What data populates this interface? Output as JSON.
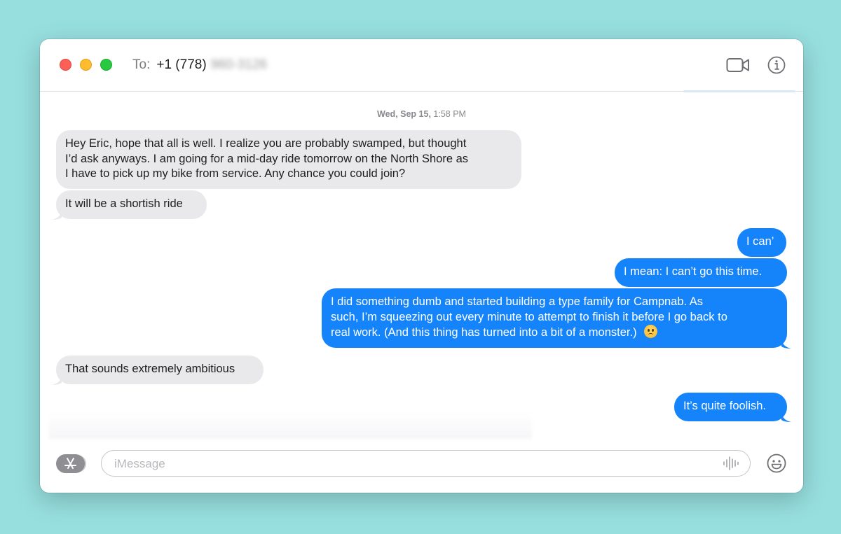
{
  "window": {
    "to_label": "To:",
    "recipient_number": "+1 (778)",
    "recipient_number_hidden": "960-3126"
  },
  "icons": {
    "video": "video-camera-icon",
    "info": "info-icon",
    "apps": "app-store-icon",
    "audio": "audio-waveform-icon",
    "emoji": "emoji-face-icon"
  },
  "colors": {
    "incoming_bubble": "#e9e9eb",
    "outgoing_bubble": "#1584fb",
    "background": "#97dfdf"
  },
  "transcript": {
    "timestamp_day": "Wed, Sep 15,",
    "timestamp_time": "1:58 PM",
    "messages": [
      {
        "direction": "incoming",
        "lines": [
          "Hey Eric, hope that all is well. I realize you are probably swamped, but thought",
          "I’d ask anyways. I am going for a mid-day ride tomorrow on the North Shore as",
          "I have to pick up my bike from service. Any chance you could join?"
        ]
      },
      {
        "direction": "incoming",
        "lines": [
          "It will be a shortish ride"
        ]
      },
      {
        "direction": "outgoing",
        "lines": [
          "I can’"
        ]
      },
      {
        "direction": "outgoing",
        "lines": [
          "I mean: I can’t go this time."
        ]
      },
      {
        "direction": "outgoing",
        "lines": [
          "I did something dumb and started building a type family for Campnab. As",
          "such, I’m squeezing out every minute to attempt to finish it before I go back to",
          "real work. (And this thing has turned into a bit of a monster.)"
        ],
        "emoji": "frowning-face"
      },
      {
        "direction": "incoming",
        "lines": [
          "That sounds extremely ambitious"
        ]
      },
      {
        "direction": "outgoing",
        "lines": [
          "It’s quite foolish."
        ]
      }
    ]
  },
  "composer": {
    "placeholder": "iMessage",
    "value": ""
  }
}
